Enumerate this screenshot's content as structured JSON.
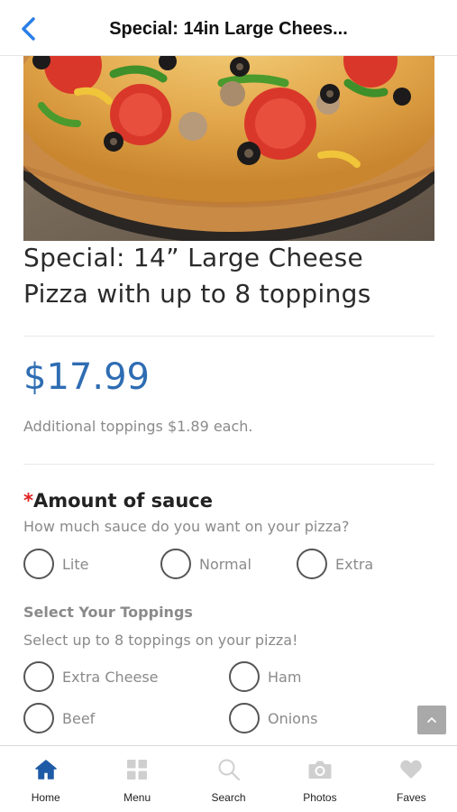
{
  "header": {
    "title": "Special: 14in Large Chees..."
  },
  "product": {
    "title_line1": "Special: 14” Large Cheese",
    "title_line2": "Pizza with up to 8 toppings",
    "price": "$17.99",
    "price_note": "Additional toppings $1.89 each."
  },
  "sauce": {
    "required_mark": "*",
    "title": "Amount of sauce",
    "subtitle": "How much sauce do you want on your pizza?",
    "options": [
      "Lite",
      "Normal",
      "Extra"
    ]
  },
  "toppings": {
    "title": "Select Your Toppings",
    "subtitle": "Select up to 8 toppings on your pizza!",
    "options": [
      "Extra Cheese",
      "Ham",
      "Beef",
      "Onions"
    ]
  },
  "tabbar": {
    "active_color": "#1f5aa6",
    "inactive_color": "#cfcfcf",
    "tabs": [
      {
        "label": "Home",
        "icon": "home-icon"
      },
      {
        "label": "Menu",
        "icon": "grid-icon"
      },
      {
        "label": "Search",
        "icon": "search-icon"
      },
      {
        "label": "Photos",
        "icon": "camera-icon"
      },
      {
        "label": "Faves",
        "icon": "heart-icon"
      }
    ]
  },
  "colors": {
    "accent": "#2f6db3",
    "back_arrow": "#2a7ee6",
    "required": "#e02020"
  }
}
